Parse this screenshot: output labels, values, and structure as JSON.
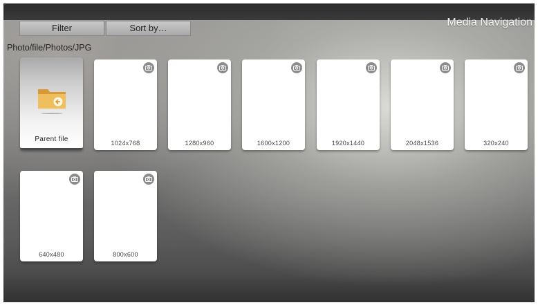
{
  "header": {
    "title": "Media Navigation",
    "filter_label": "Filter",
    "sort_label": "Sort by…"
  },
  "breadcrumb": "Photo/file/Photos/JPG",
  "parent": {
    "label": "Parent file",
    "icon": "folder-back-icon"
  },
  "files": [
    {
      "label": "1024x768",
      "icon": "camera-icon"
    },
    {
      "label": "1280x960",
      "icon": "camera-icon"
    },
    {
      "label": "1600x1200",
      "icon": "camera-icon"
    },
    {
      "label": "1920x1440",
      "icon": "camera-icon"
    },
    {
      "label": "2048x1536",
      "icon": "camera-icon"
    },
    {
      "label": "320x240",
      "icon": "camera-icon"
    },
    {
      "label": "640x480",
      "icon": "camera-icon"
    },
    {
      "label": "800x600",
      "icon": "camera-icon"
    }
  ],
  "colors": {
    "folder": "#e8b352",
    "folder_badge": "#fff6e0"
  }
}
